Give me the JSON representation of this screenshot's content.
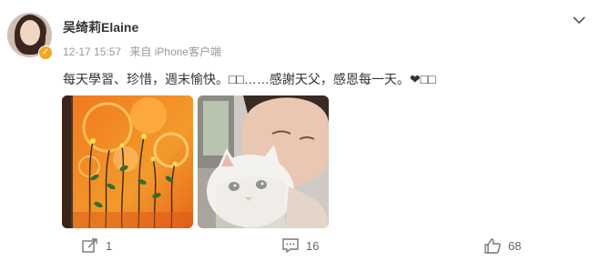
{
  "post": {
    "username": "吴绮莉Elaine",
    "timestamp": "12-17 15:57",
    "source": "来自 iPhone客户端",
    "text": "每天學習、珍惜，週末愉快。□□……感謝天父，感恩每一天。❤□□"
  },
  "images": [
    {
      "name": "painting-photo"
    },
    {
      "name": "cat-selfie-photo"
    }
  ],
  "actions": {
    "share_count": "1",
    "comment_count": "16",
    "like_count": "68"
  },
  "icons": {
    "verified": "verified-badge-icon",
    "menu": "chevron-down-icon",
    "share": "share-icon",
    "comment": "comment-icon",
    "like": "thumbs-up-icon"
  },
  "colors": {
    "verified_badge": "#f6a623",
    "meta_text": "#999999",
    "body_text": "#333333"
  }
}
